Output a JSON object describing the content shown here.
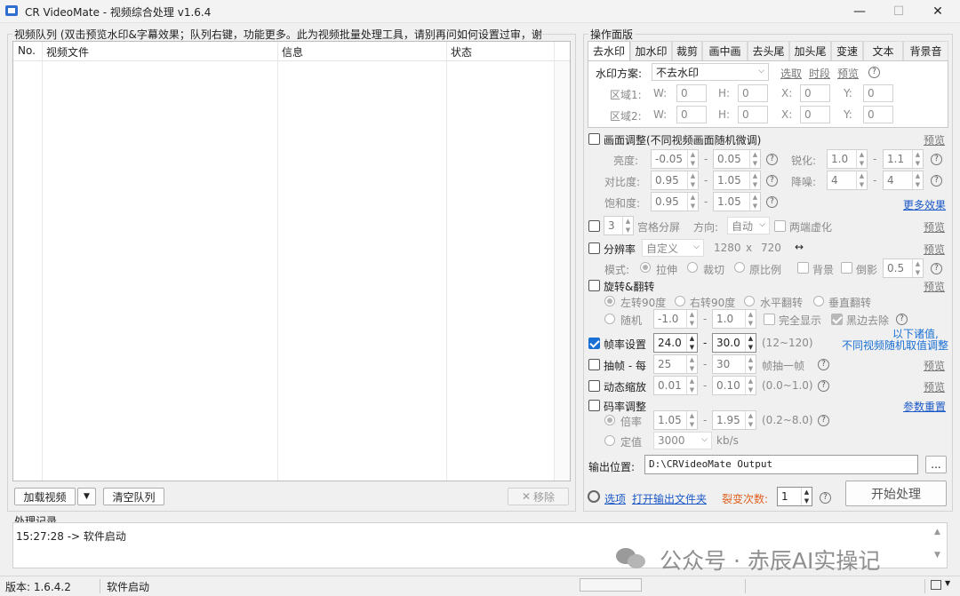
{
  "window": {
    "title": "CR VideoMate - 视频综合处理 v1.6.4",
    "min": "—",
    "max": "☐",
    "close": "✕"
  },
  "queue": {
    "group_title": "视频队列 (双击预览水印&字幕效果；队列右键，功能更多。此为视频批量处理工具，请别再问如何设置过审，谢~)",
    "columns": [
      "No.",
      "视频文件",
      "信息",
      "状态"
    ],
    "add_button": "加载视频",
    "add_dropdown": "▼",
    "clear_button": "清空队列",
    "remove_button": "移除",
    "remove_icon": "✕"
  },
  "panel": {
    "group_title": "操作面版",
    "tabs": [
      "去水印",
      "加水印",
      "裁剪",
      "画中画",
      "去头尾",
      "加头尾",
      "变速",
      "文本",
      "背景音"
    ],
    "watermark": {
      "scheme_label": "水印方案:",
      "scheme_value": "不去水印",
      "pick": "选取",
      "timeseg": "时段",
      "preview": "预览",
      "region1_label": "区域1:",
      "region2_label": "区域2:",
      "w": "W:",
      "h": "H:",
      "x": "X:",
      "y": "Y:",
      "zero": "0"
    },
    "adjust": {
      "label": "画面调整(不同视频画面随机微调)",
      "preview": "预览",
      "brightness": "亮度:",
      "b_lo": "-0.05",
      "b_hi": "0.05",
      "sharpen": "锐化:",
      "s_lo": "1.0",
      "s_hi": "1.1",
      "contrast": "对比度:",
      "c_lo": "0.95",
      "c_hi": "1.05",
      "denoise": "降噪:",
      "d_lo": "4",
      "d_hi": "4",
      "saturation": "饱和度:",
      "sa_lo": "0.95",
      "sa_hi": "1.05",
      "more": "更多效果"
    },
    "grid": {
      "count": "3",
      "label": "宫格分屏",
      "dir_label": "方向:",
      "dir_value": "自动",
      "blur_label": "两端虚化",
      "preview": "预览"
    },
    "resolution": {
      "label": "分辨率",
      "preset": "自定义",
      "w": "1280",
      "x": "x",
      "h": "720",
      "swap": "↔",
      "preview": "预览",
      "mode_label": "模式:",
      "stretch": "拉伸",
      "crop": "裁切",
      "ratio": "原比例",
      "bg": "背景",
      "reflect": "倒影",
      "reflect_val": "0.5"
    },
    "rotate": {
      "label": "旋转&翻转",
      "preview": "预览",
      "left90": "左转90度",
      "right90": "右转90度",
      "hflip": "水平翻转",
      "vflip": "垂直翻转",
      "random": "随机",
      "r_lo": "-1.0",
      "r_hi": "1.0",
      "full": "完全显示",
      "black": "黑边去除"
    },
    "note": [
      "以下诸值,",
      "不同视频随机取值调整"
    ],
    "fps": {
      "label": "帧率设置",
      "lo": "24.0",
      "hi": "30.0",
      "range": "(12~120)"
    },
    "extract": {
      "label": "抽帧 - 每",
      "lo": "25",
      "hi": "30",
      "unit": "帧抽一帧",
      "preview": "预览"
    },
    "zoom": {
      "label": "动态缩放",
      "lo": "0.01",
      "hi": "0.10",
      "range": "(0.0~1.0)",
      "preview": "预览"
    },
    "bitrate": {
      "label": "码率调整",
      "reset": "参数重置",
      "ratio": "倍率",
      "r_lo": "1.05",
      "r_hi": "1.95",
      "range": "(0.2~8.0)",
      "fixed": "定值",
      "fixed_val": "3000",
      "unit": "kb/s"
    },
    "output": {
      "label": "输出位置:",
      "path": "D:\\CRVideoMate Output",
      "browse": "..."
    },
    "bottom": {
      "options": "选项",
      "open_folder": "打开输出文件夹",
      "fission": "裂变次数:",
      "fission_val": "1",
      "start": "开始处理"
    }
  },
  "log": {
    "title": "处理记录",
    "lines": [
      "15:27:28 -> 软件启动"
    ],
    "watermark": "公众号 · 赤辰AI实操记"
  },
  "status": {
    "version": "版本: 1.6.4.2",
    "state": "软件启动"
  },
  "colors": {
    "accent": "#1a58c7",
    "orange": "#e06020",
    "select_blue": "#1a6fd4"
  }
}
